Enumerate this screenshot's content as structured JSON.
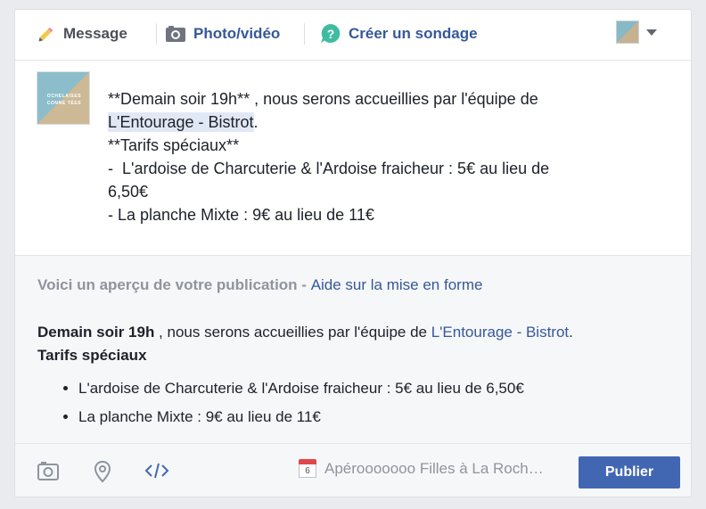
{
  "tabs": {
    "message": "Message",
    "photo_video": "Photo/vidéo",
    "poll": "Créer un sondage"
  },
  "avatar": {
    "line1": "OCHELAISES",
    "line2": "CONNE TÉES"
  },
  "post": {
    "line1": "**Demain soir 19h** , nous serons accueillies par l'équipe de",
    "mention": "L'Entourage - Bistrot",
    "mention_after": ".",
    "line3": "**Tarifs spéciaux**",
    "line4": "-  L'ardoise de Charcuterie & l'Ardoise fraicheur : 5€ au lieu de",
    "line5": "6,50€",
    "line6": "- La planche Mixte : 9€ au lieu de 11€"
  },
  "preview": {
    "label": "Voici un aperçu de votre publication - ",
    "help_link": "Aide sur la mise en forme",
    "bold_start": "Demain soir 19h",
    "text_mid": " , nous serons accueillies par l'équipe de ",
    "mention": "L'Entourage - Bistrot",
    "text_end": ".",
    "bold_line2": "Tarifs spéciaux",
    "items": [
      "L'ardoise de Charcuterie & l'Ardoise fraicheur : 5€ au lieu de 6,50€",
      "La planche Mixte : 9€ au lieu de 11€"
    ]
  },
  "footer": {
    "calendar_day": "6",
    "event_name": "Apérooooooo Filles à La Roch…",
    "publish": "Publier"
  },
  "colors": {
    "link": "#365899",
    "publish_button": "#4267b2",
    "muted": "#90949c"
  }
}
